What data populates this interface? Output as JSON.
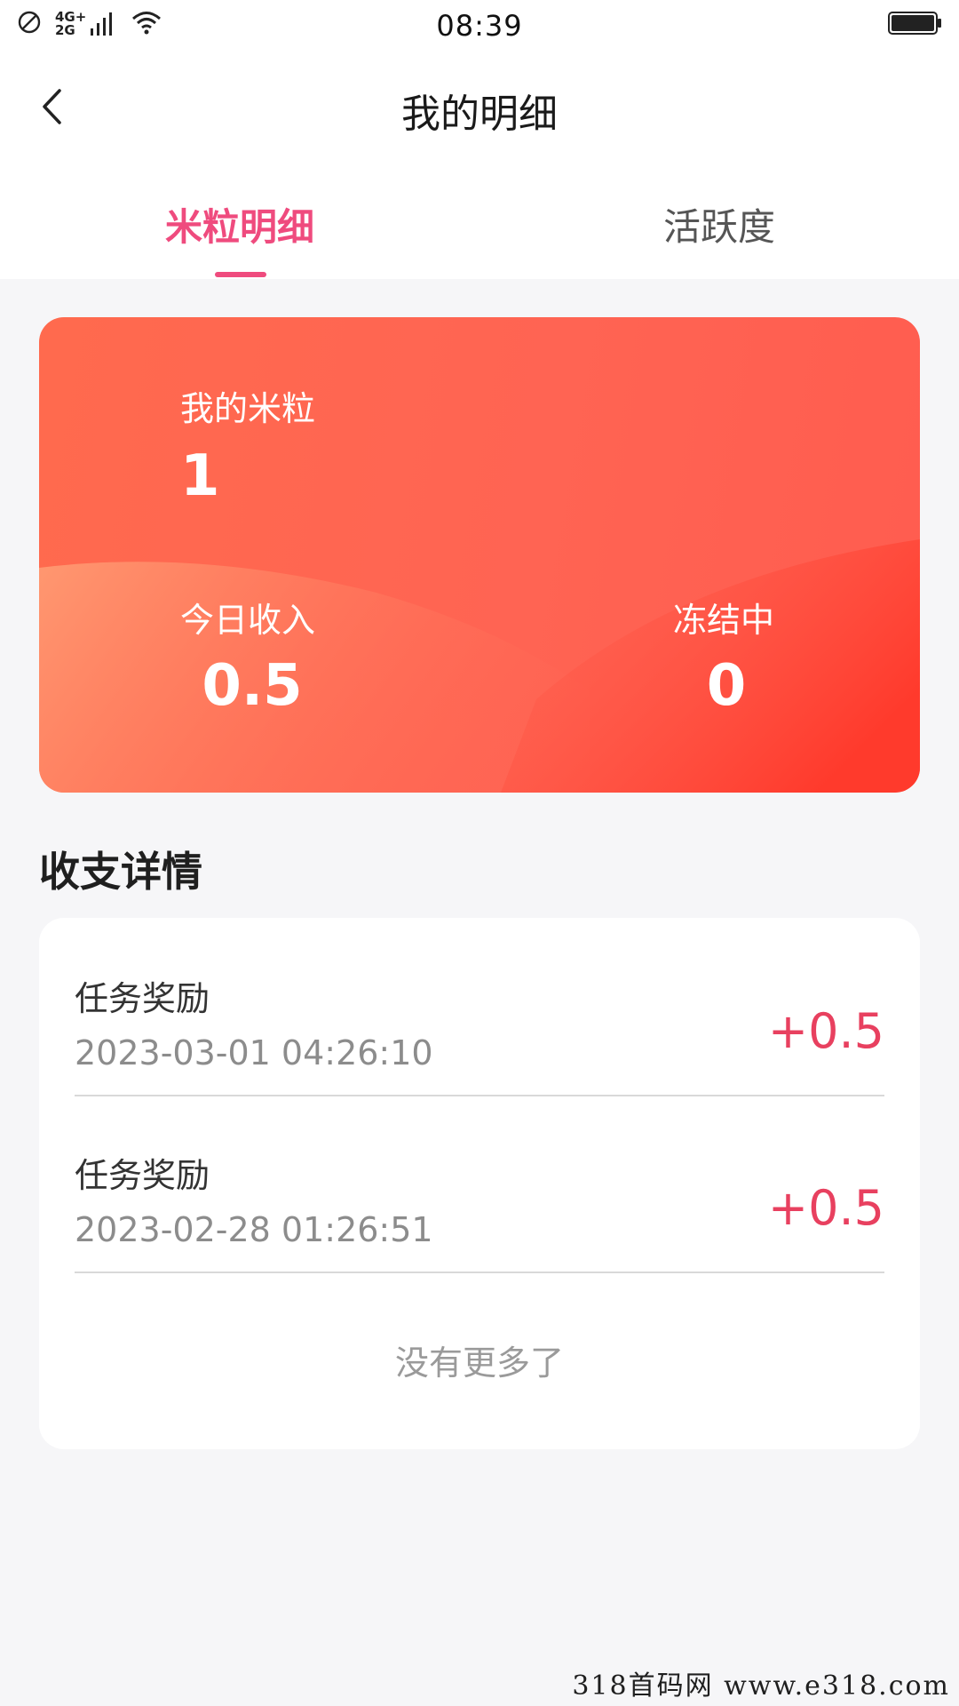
{
  "status_bar": {
    "time": "08:39",
    "network_top": "4G+",
    "network_bottom": "2G",
    "icons": [
      "no-sim-icon",
      "signal-icon",
      "wifi-icon",
      "battery-icon"
    ]
  },
  "nav": {
    "title": "我的明细",
    "back_icon": "chevron-left-icon"
  },
  "tabs": [
    {
      "label": "米粒明细",
      "active": true
    },
    {
      "label": "活跃度",
      "active": false
    }
  ],
  "balance_card": {
    "total_label": "我的米粒",
    "total_value": "1",
    "today_label": "今日收入",
    "today_value": "0.5",
    "frozen_label": "冻结中",
    "frozen_value": "0"
  },
  "details": {
    "section_title": "收支详情",
    "records": [
      {
        "title": "任务奖励",
        "time": "2023-03-01 04:26:10",
        "amount": "+0.5"
      },
      {
        "title": "任务奖励",
        "time": "2023-02-28 01:26:51",
        "amount": "+0.5"
      }
    ],
    "no_more": "没有更多了"
  },
  "watermark": "318首码网 www.e318.com",
  "colors": {
    "accent": "#ef4b7e",
    "amount": "#e8405f",
    "card_start": "#ff6a4e",
    "card_end": "#ff3b30",
    "background": "#f6f6f8"
  }
}
